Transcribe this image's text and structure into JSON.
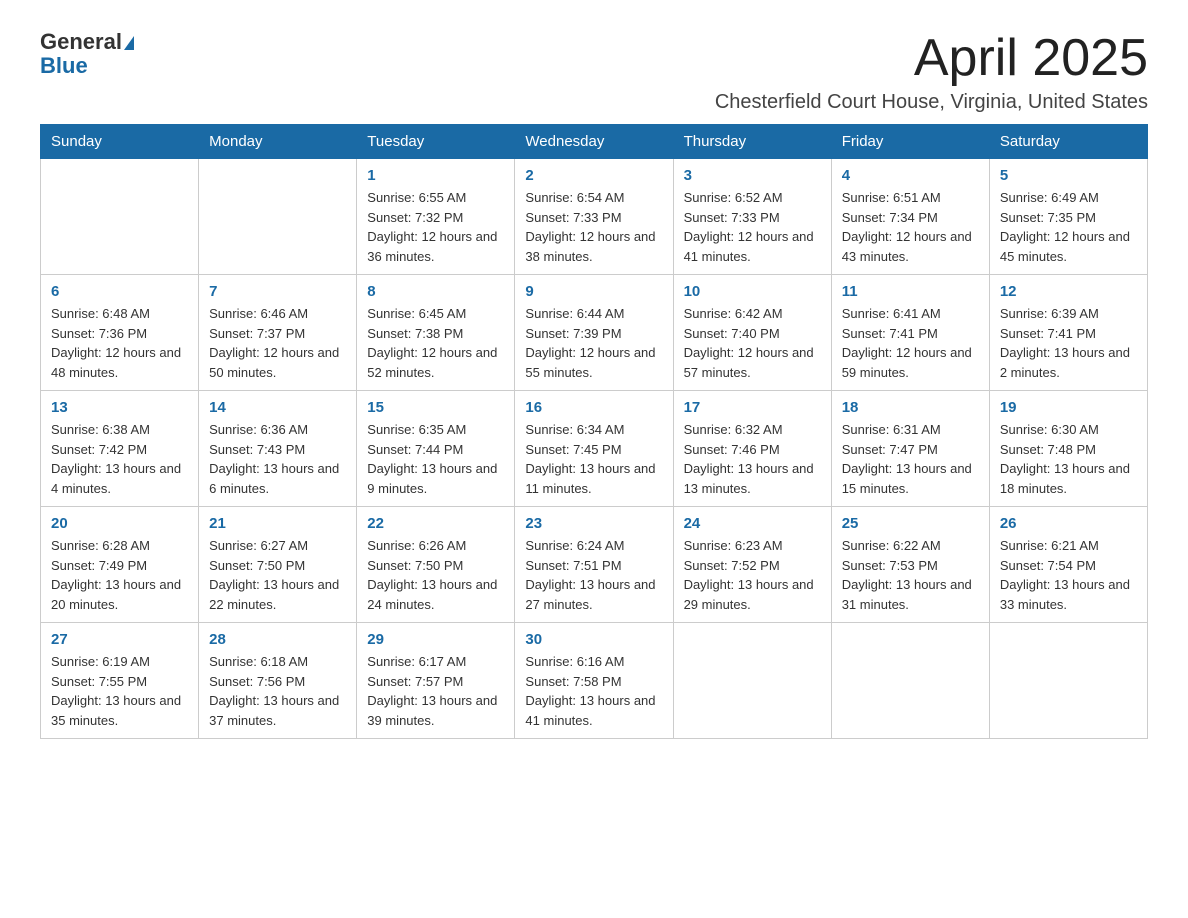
{
  "logo": {
    "general": "General",
    "blue": "Blue"
  },
  "header": {
    "month_year": "April 2025",
    "location": "Chesterfield Court House, Virginia, United States"
  },
  "weekdays": [
    "Sunday",
    "Monday",
    "Tuesday",
    "Wednesday",
    "Thursday",
    "Friday",
    "Saturday"
  ],
  "weeks": [
    [
      {
        "day": "",
        "sunrise": "",
        "sunset": "",
        "daylight": ""
      },
      {
        "day": "",
        "sunrise": "",
        "sunset": "",
        "daylight": ""
      },
      {
        "day": "1",
        "sunrise": "Sunrise: 6:55 AM",
        "sunset": "Sunset: 7:32 PM",
        "daylight": "Daylight: 12 hours and 36 minutes."
      },
      {
        "day": "2",
        "sunrise": "Sunrise: 6:54 AM",
        "sunset": "Sunset: 7:33 PM",
        "daylight": "Daylight: 12 hours and 38 minutes."
      },
      {
        "day": "3",
        "sunrise": "Sunrise: 6:52 AM",
        "sunset": "Sunset: 7:33 PM",
        "daylight": "Daylight: 12 hours and 41 minutes."
      },
      {
        "day": "4",
        "sunrise": "Sunrise: 6:51 AM",
        "sunset": "Sunset: 7:34 PM",
        "daylight": "Daylight: 12 hours and 43 minutes."
      },
      {
        "day": "5",
        "sunrise": "Sunrise: 6:49 AM",
        "sunset": "Sunset: 7:35 PM",
        "daylight": "Daylight: 12 hours and 45 minutes."
      }
    ],
    [
      {
        "day": "6",
        "sunrise": "Sunrise: 6:48 AM",
        "sunset": "Sunset: 7:36 PM",
        "daylight": "Daylight: 12 hours and 48 minutes."
      },
      {
        "day": "7",
        "sunrise": "Sunrise: 6:46 AM",
        "sunset": "Sunset: 7:37 PM",
        "daylight": "Daylight: 12 hours and 50 minutes."
      },
      {
        "day": "8",
        "sunrise": "Sunrise: 6:45 AM",
        "sunset": "Sunset: 7:38 PM",
        "daylight": "Daylight: 12 hours and 52 minutes."
      },
      {
        "day": "9",
        "sunrise": "Sunrise: 6:44 AM",
        "sunset": "Sunset: 7:39 PM",
        "daylight": "Daylight: 12 hours and 55 minutes."
      },
      {
        "day": "10",
        "sunrise": "Sunrise: 6:42 AM",
        "sunset": "Sunset: 7:40 PM",
        "daylight": "Daylight: 12 hours and 57 minutes."
      },
      {
        "day": "11",
        "sunrise": "Sunrise: 6:41 AM",
        "sunset": "Sunset: 7:41 PM",
        "daylight": "Daylight: 12 hours and 59 minutes."
      },
      {
        "day": "12",
        "sunrise": "Sunrise: 6:39 AM",
        "sunset": "Sunset: 7:41 PM",
        "daylight": "Daylight: 13 hours and 2 minutes."
      }
    ],
    [
      {
        "day": "13",
        "sunrise": "Sunrise: 6:38 AM",
        "sunset": "Sunset: 7:42 PM",
        "daylight": "Daylight: 13 hours and 4 minutes."
      },
      {
        "day": "14",
        "sunrise": "Sunrise: 6:36 AM",
        "sunset": "Sunset: 7:43 PM",
        "daylight": "Daylight: 13 hours and 6 minutes."
      },
      {
        "day": "15",
        "sunrise": "Sunrise: 6:35 AM",
        "sunset": "Sunset: 7:44 PM",
        "daylight": "Daylight: 13 hours and 9 minutes."
      },
      {
        "day": "16",
        "sunrise": "Sunrise: 6:34 AM",
        "sunset": "Sunset: 7:45 PM",
        "daylight": "Daylight: 13 hours and 11 minutes."
      },
      {
        "day": "17",
        "sunrise": "Sunrise: 6:32 AM",
        "sunset": "Sunset: 7:46 PM",
        "daylight": "Daylight: 13 hours and 13 minutes."
      },
      {
        "day": "18",
        "sunrise": "Sunrise: 6:31 AM",
        "sunset": "Sunset: 7:47 PM",
        "daylight": "Daylight: 13 hours and 15 minutes."
      },
      {
        "day": "19",
        "sunrise": "Sunrise: 6:30 AM",
        "sunset": "Sunset: 7:48 PM",
        "daylight": "Daylight: 13 hours and 18 minutes."
      }
    ],
    [
      {
        "day": "20",
        "sunrise": "Sunrise: 6:28 AM",
        "sunset": "Sunset: 7:49 PM",
        "daylight": "Daylight: 13 hours and 20 minutes."
      },
      {
        "day": "21",
        "sunrise": "Sunrise: 6:27 AM",
        "sunset": "Sunset: 7:50 PM",
        "daylight": "Daylight: 13 hours and 22 minutes."
      },
      {
        "day": "22",
        "sunrise": "Sunrise: 6:26 AM",
        "sunset": "Sunset: 7:50 PM",
        "daylight": "Daylight: 13 hours and 24 minutes."
      },
      {
        "day": "23",
        "sunrise": "Sunrise: 6:24 AM",
        "sunset": "Sunset: 7:51 PM",
        "daylight": "Daylight: 13 hours and 27 minutes."
      },
      {
        "day": "24",
        "sunrise": "Sunrise: 6:23 AM",
        "sunset": "Sunset: 7:52 PM",
        "daylight": "Daylight: 13 hours and 29 minutes."
      },
      {
        "day": "25",
        "sunrise": "Sunrise: 6:22 AM",
        "sunset": "Sunset: 7:53 PM",
        "daylight": "Daylight: 13 hours and 31 minutes."
      },
      {
        "day": "26",
        "sunrise": "Sunrise: 6:21 AM",
        "sunset": "Sunset: 7:54 PM",
        "daylight": "Daylight: 13 hours and 33 minutes."
      }
    ],
    [
      {
        "day": "27",
        "sunrise": "Sunrise: 6:19 AM",
        "sunset": "Sunset: 7:55 PM",
        "daylight": "Daylight: 13 hours and 35 minutes."
      },
      {
        "day": "28",
        "sunrise": "Sunrise: 6:18 AM",
        "sunset": "Sunset: 7:56 PM",
        "daylight": "Daylight: 13 hours and 37 minutes."
      },
      {
        "day": "29",
        "sunrise": "Sunrise: 6:17 AM",
        "sunset": "Sunset: 7:57 PM",
        "daylight": "Daylight: 13 hours and 39 minutes."
      },
      {
        "day": "30",
        "sunrise": "Sunrise: 6:16 AM",
        "sunset": "Sunset: 7:58 PM",
        "daylight": "Daylight: 13 hours and 41 minutes."
      },
      {
        "day": "",
        "sunrise": "",
        "sunset": "",
        "daylight": ""
      },
      {
        "day": "",
        "sunrise": "",
        "sunset": "",
        "daylight": ""
      },
      {
        "day": "",
        "sunrise": "",
        "sunset": "",
        "daylight": ""
      }
    ]
  ]
}
